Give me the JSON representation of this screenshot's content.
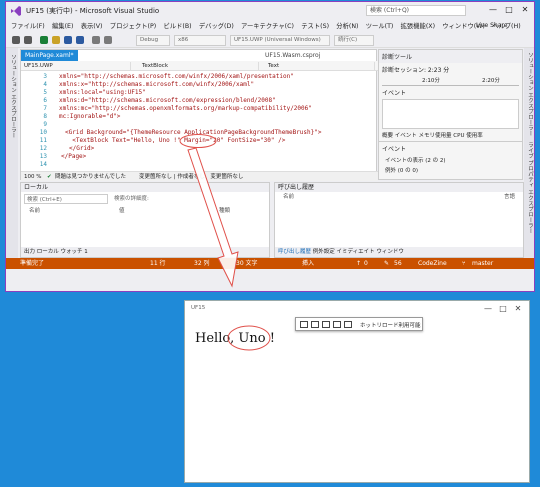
{
  "vs": {
    "title": "UF15 (実行中) - Microsoft Visual Studio",
    "quick_launch": "検索 (Ctrl+Q)",
    "win_buttons": [
      "—",
      "□",
      "✕"
    ],
    "menu": [
      "ファイル(F)",
      "編集(E)",
      "表示(V)",
      "プロジェクト(P)",
      "ビルド(B)",
      "デバッグ(D)",
      "アーキテクチャ(C)",
      "テスト(S)",
      "分析(N)",
      "ツール(T)",
      "拡張機能(X)",
      "ウィンドウ(W)",
      "ヘルプ(H)"
    ],
    "live_share": "Live Share",
    "toolbar": {
      "config": "Debug",
      "platform": "x86",
      "target": "UF15.UWP (Universal Windows)",
      "continue": "続行(C)"
    },
    "left_rail": [
      "ソリューション エクスプローラー"
    ],
    "right_rail": [
      "ソリューション エクスプローラー",
      "ライブ プロパティ エクスプローラー"
    ],
    "editor": {
      "tabs": [
        "MainPage.xaml*",
        "UF15.Wasm.csproj"
      ],
      "nav": [
        "UF15.UWP",
        "TextBlock",
        "Text"
      ],
      "lines": [
        {
          "n": "3",
          "code": "xmlns=\"http://schemas.microsoft.com/winfx/2006/xaml/presentation\""
        },
        {
          "n": "4",
          "code": "xmlns:x=\"http://schemas.microsoft.com/winfx/2006/xaml\""
        },
        {
          "n": "5",
          "code": "xmlns:local=\"using:UF15\""
        },
        {
          "n": "6",
          "code": "xmlns:d=\"http://schemas.microsoft.com/expression/blend/2008\""
        },
        {
          "n": "7",
          "code": "xmlns:mc=\"http://schemas.openxmlformats.org/markup-compatibility/2006\""
        },
        {
          "n": "8",
          "code": "mc:Ignorable=\"d\">"
        },
        {
          "n": "9",
          "code": ""
        },
        {
          "n": "10",
          "code": "<Grid Background=\"{ThemeResource ApplicationPageBackgroundThemeBrush}\">"
        },
        {
          "n": "11",
          "code": "  <TextBlock Text=\"Hello, Uno !\" Margin=\"20\" FontSize=\"30\" />"
        },
        {
          "n": "12",
          "code": "</Grid>"
        },
        {
          "n": "13",
          "code": "</Page>"
        },
        {
          "n": "14",
          "code": ""
        }
      ],
      "zoom": "100 %",
      "issues": "問題は見つかりませんでした",
      "change_nav": "変更箇所なし | 作成者なし、変更箇所なし"
    },
    "diag": {
      "title": "診断ツール",
      "session": "診断セッション: 2:23 分",
      "times": [
        "2:10分",
        "2:20分"
      ],
      "events": "イベント",
      "tabs": [
        "概要",
        "イベント",
        "メモリ使用量",
        "CPU 使用率"
      ],
      "events_header": "イベント",
      "ev1": "イベントの表示 (2 の 2)",
      "ev2": "例外 (0 の 0)"
    },
    "locals": {
      "title": "ローカル",
      "search": "検索 (Ctrl+E)",
      "depth": "検索の詳細度:",
      "cols": [
        "名前",
        "値",
        "種類"
      ],
      "tabs": [
        "出力",
        "ローカル",
        "ウォッチ 1"
      ]
    },
    "callstack": {
      "title": "呼び出し履歴",
      "cols": [
        "名前",
        "言語"
      ],
      "tabs": [
        "呼び出し履歴",
        "例外設定",
        "イミディエイト ウィンドウ"
      ]
    },
    "status": {
      "ready": "準備完了",
      "line": "11 行",
      "col": "32 列",
      "char": "30 文字",
      "ins": "挿入",
      "up": "0",
      "pencil": "56",
      "repo": "CodeZine",
      "branch": "master"
    }
  },
  "app": {
    "title": "UF15",
    "hello": "Hello, Uno !",
    "hot_reload": "ホットリロード利用可能",
    "win_buttons": [
      "—",
      "□",
      "✕"
    ]
  },
  "colors": {
    "vs_purple": "#8a3fbf",
    "status_orange": "#ca5100",
    "desktop_blue": "#1f8ad8",
    "annotation_red": "#e0504a"
  }
}
